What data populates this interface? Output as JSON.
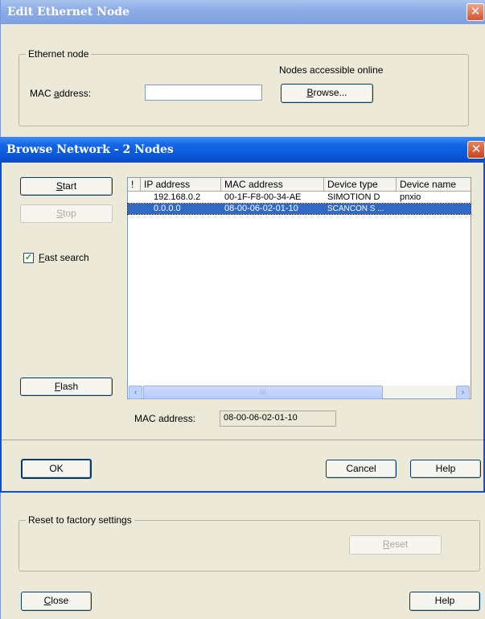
{
  "edit_window": {
    "title": "Edit Ethernet Node",
    "close_glyph": "✕",
    "ethernet_group": {
      "label": "Ethernet node",
      "nodes_accessible_online": "Nodes accessible online",
      "mac_label_prefix": "MAC ",
      "mac_label_u": "a",
      "mac_label_suffix": "ddress:",
      "mac_value": "",
      "browse_u": "B",
      "browse_rest": "rowse..."
    },
    "reset_group": {
      "label": "Reset to factory settings",
      "reset_u": "R",
      "reset_rest": "eset"
    },
    "close_u": "C",
    "close_rest": "lose",
    "help_label": "Help"
  },
  "browse_window": {
    "title": "Browse Network - 2 Nodes",
    "close_glyph": "✕",
    "start_u": "S",
    "start_rest": "tart",
    "stop_u": "S",
    "stop_rest": "top",
    "fast_search_checked": true,
    "check_glyph": "✓",
    "fast_search_u": "F",
    "fast_search_rest": "ast search",
    "flash_u": "F",
    "flash_rest": "lash",
    "list": {
      "columns": [
        "!",
        "IP address",
        "MAC address",
        "Device type",
        "Device name"
      ],
      "rows": [
        {
          "flag": "",
          "ip": "192.168.0.2",
          "mac": "00-1F-F8-00-34-AE",
          "type": "SIMOTION D",
          "name": "pnxio",
          "selected": false
        },
        {
          "flag": "",
          "ip": "0.0.0.0",
          "mac": "08-00-06-02-01-10",
          "type": "SCANCON S ...",
          "name": "",
          "selected": true
        }
      ],
      "scroll_left": "‹",
      "scroll_right": "›",
      "thumb_grip": "III"
    },
    "mac_label": "MAC address:",
    "mac_value": "08-00-06-02-01-10",
    "ok_label": "OK",
    "cancel_label": "Cancel",
    "help_label": "Help"
  }
}
